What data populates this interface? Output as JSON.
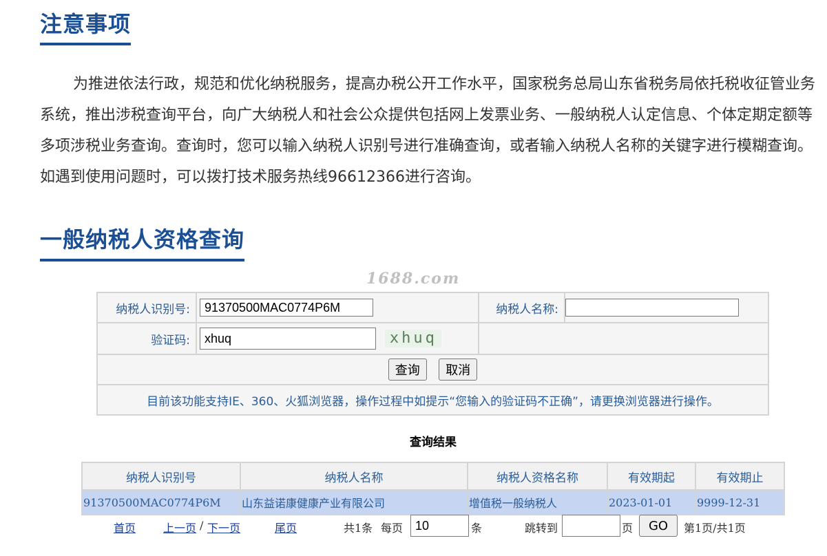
{
  "notice": {
    "title": "注意事项",
    "text": "为推进依法行政，规范和优化纳税服务，提高办税公开工作水平，国家税务总局山东省税务局依托税收征管业务系统，推出涉税查询平台，向广大纳税人和社会公众提供包括网上发票业务、一般纳税人认定信息、个体定期定额等多项涉税业务查询。查询时，您可以输入纳税人识别号进行准确查询，或者输入纳税人名称的关键字进行模糊查询。如遇到使用问题时，可以拨打技术服务热线96612366进行咨询。"
  },
  "query": {
    "title": "一般纳税人资格查询",
    "watermark": "1688.com",
    "taxpayer_id_label": "纳税人识别号:",
    "taxpayer_id_value": "91370500MAC0774P6M",
    "taxpayer_name_label": "纳税人名称:",
    "taxpayer_name_value": "",
    "captcha_label": "验证码:",
    "captcha_value": "xhuq",
    "captcha_image_text": "xhuq",
    "search_button": "查询",
    "cancel_button": "取消",
    "tip": "目前该功能支持IE、360、火狐浏览器，操作过程中如提示“您输入的验证码不正确”，请更换浏览器进行操作。"
  },
  "results": {
    "title": "查询结果",
    "columns": [
      "纳税人识别号",
      "纳税人名称",
      "纳税人资格名称",
      "有效期起",
      "有效期止"
    ],
    "rows": [
      [
        "91370500MAC0774P6M",
        "山东益诺康健康产业有限公司",
        "增值税一般纳税人",
        "2023-01-01",
        "9999-12-31"
      ]
    ]
  },
  "pager": {
    "first": "首页",
    "prev": "上一页",
    "separator": "/",
    "next": "下一页",
    "last": "尾页",
    "total": "共1条",
    "per_page_label": "每页",
    "per_page_value": "10",
    "per_page_unit": "条",
    "jump_label": "跳转到",
    "jump_value": "",
    "page_unit": "页",
    "go_button": "GO",
    "page_info": "第1页/共1页"
  }
}
